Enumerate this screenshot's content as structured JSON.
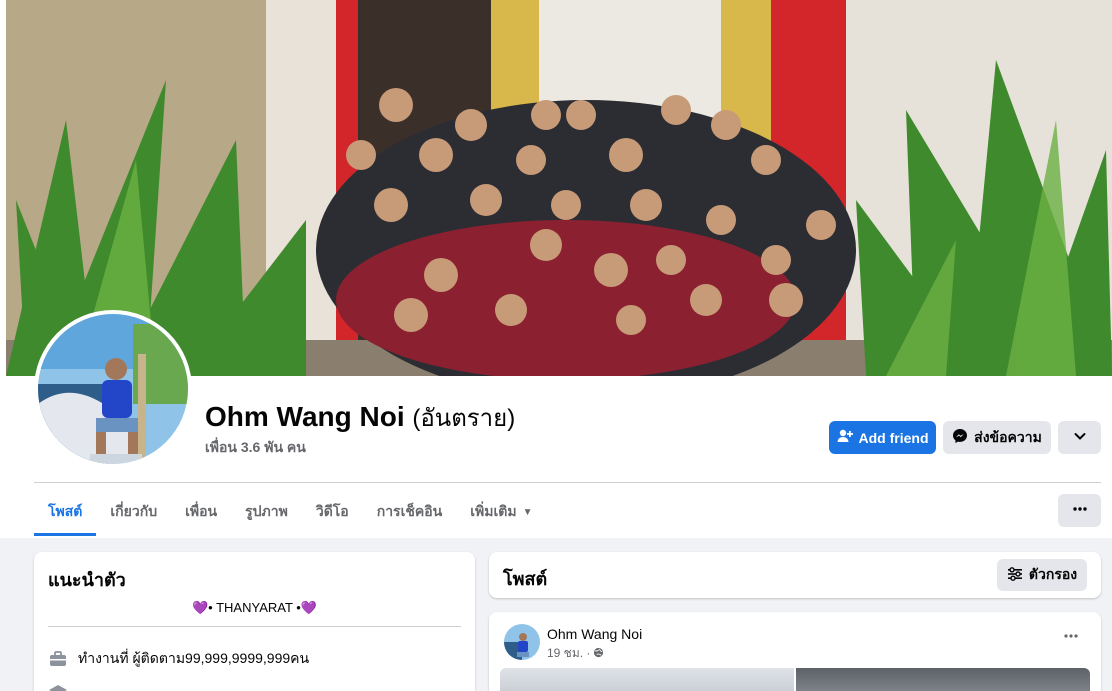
{
  "profile": {
    "name": "Ohm Wang Noi",
    "alt_name": "(อันตราย)",
    "friends": "เพื่อน 3.6 พัน คน"
  },
  "actions": {
    "add_friend": "Add friend",
    "message": "ส่งข้อความ"
  },
  "tabs": [
    {
      "label": "โพสต์"
    },
    {
      "label": "เกี่ยวกับ"
    },
    {
      "label": "เพื่อน"
    },
    {
      "label": "รูปภาพ"
    },
    {
      "label": "วิดีโอ"
    },
    {
      "label": "การเช็คอิน"
    },
    {
      "label": "เพิ่มเติม"
    }
  ],
  "intro": {
    "title": "แนะนำตัว",
    "bio": "💜• THANYARAT •💜",
    "work": "ทำงานที่ ผู้ติดตาม99,999,9999,999คน"
  },
  "posts_section": {
    "title": "โพสต์",
    "filter_label": "ตัวกรอง"
  },
  "post": {
    "author": "Ohm Wang Noi",
    "time": "19 ชม. ·"
  },
  "colors": {
    "accent": "#1b74e4",
    "background": "#f0f2f5",
    "text_secondary": "#65676b"
  },
  "icons": [
    "add-friend-icon",
    "messenger-icon",
    "chevron-down-icon",
    "more-icon",
    "filter-icon",
    "briefcase-icon",
    "globe-icon"
  ]
}
